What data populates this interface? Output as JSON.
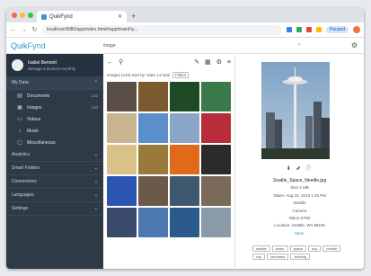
{
  "browser": {
    "tab_title": "QuikFynd",
    "url": "localhost:8080/app/index.html#/app/mainFiy...",
    "profile_status": "Paused",
    "colors": {
      "close": "#ff5f57",
      "min": "#febc2e",
      "max": "#28c840"
    }
  },
  "app": {
    "logo_prefix": "Quik",
    "logo_suffix": "Fynd",
    "search_query": "image",
    "settings_icon": "gear-icon"
  },
  "sidebar": {
    "user_name": "Isabel Bennett",
    "user_sub": "Storage 3 devices monthly",
    "sections": [
      {
        "label": "My Data",
        "open": true
      },
      {
        "label": "Analytics"
      },
      {
        "label": "Smart Folders"
      },
      {
        "label": "Connections"
      },
      {
        "label": "Languages"
      },
      {
        "label": "Settings"
      }
    ],
    "items": [
      {
        "label": "Documents",
        "count": "142",
        "icon": "document-icon"
      },
      {
        "label": "Images",
        "count": "140",
        "icon": "image-icon"
      },
      {
        "label": "Videos",
        "count": "",
        "icon": "video-icon"
      },
      {
        "label": "Music",
        "count": "",
        "icon": "music-icon"
      },
      {
        "label": "Miscellaneous",
        "count": "",
        "icon": "folder-icon"
      }
    ]
  },
  "middle": {
    "filter_text": "Images (140)  Sort by: Date  14 total",
    "chip": "Filters",
    "tiles": [
      "#5a4e47",
      "#7a5a2e",
      "#1e4a28",
      "#3a7a4a",
      "#c9b490",
      "#5b8fcc",
      "#8aa6c8",
      "#b82d3a",
      "#d9c28a",
      "#9a7a3a",
      "#e06a1a",
      "#2b2b2b",
      "#2a55b0",
      "#6b5a4a",
      "#3e5870",
      "#7a6a5a",
      "#3a4a6a",
      "#4a7ab0",
      "#2a5a8a",
      "#8a9aa8"
    ]
  },
  "detail": {
    "filename": "Seattle_Space_Needle.jpg",
    "lines": [
      "Size 2 MB",
      "Taken: Aug 24, 2019 1:25 PM",
      "Seattle",
      "Camera",
      "Nikon D750",
      "Location: Seattle, WA 98109"
    ],
    "more_link": "More",
    "tags": [
      "seattle",
      "tower",
      "space",
      "sky",
      "needle",
      "city",
      "landmark",
      "building"
    ]
  }
}
